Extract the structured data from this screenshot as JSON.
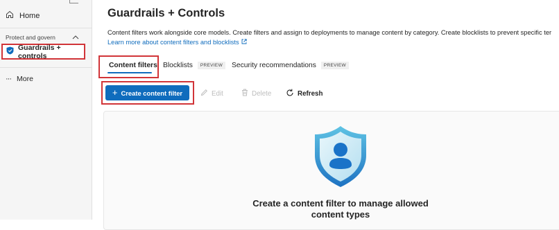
{
  "sidebar": {
    "home_label": "Home",
    "section_label": "Protect and govern",
    "active_item_label": "Guardrails + controls",
    "more_label": "More"
  },
  "page": {
    "title": "Guardrails + Controls",
    "description": "Content filters work alongside core models. Create filters and assign to deployments to manage content by category. Create blocklists to prevent specific ter",
    "learn_more": "Learn more about content filters and blocklists"
  },
  "tabs": [
    {
      "label": "Content filters",
      "badge": "",
      "active": true
    },
    {
      "label": "Blocklists",
      "badge": "PREVIEW",
      "active": false
    },
    {
      "label": "Security recommendations",
      "badge": "PREVIEW",
      "active": false
    }
  ],
  "toolbar": {
    "create_label": "Create content filter",
    "edit_label": "Edit",
    "delete_label": "Delete",
    "refresh_label": "Refresh"
  },
  "empty_state": {
    "title": "Create a content filter to manage allowed content types"
  },
  "colors": {
    "accent": "#0f6cbd",
    "highlight": "#d13438"
  }
}
